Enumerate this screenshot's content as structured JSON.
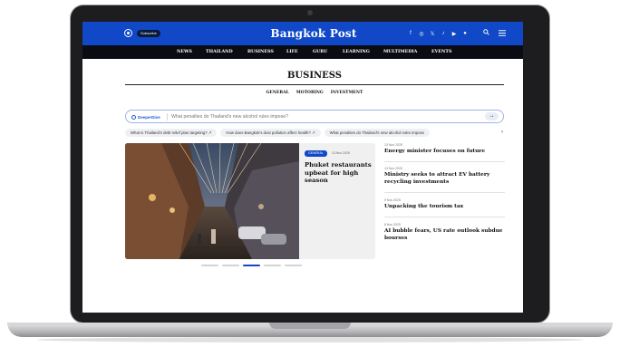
{
  "header": {
    "subscribe_label": "Subscribe",
    "logo_text": "Bangkok Post",
    "social_icons": [
      "facebook-icon",
      "instagram-icon",
      "x-icon",
      "tiktok-icon",
      "youtube-icon",
      "line-icon"
    ],
    "brand_color": "#1048c8"
  },
  "nav": {
    "items": [
      "NEWS",
      "THAILAND",
      "BUSINESS",
      "LIFE",
      "GURU",
      "LEARNING",
      "MULTIMEDIA",
      "EVENTS"
    ]
  },
  "section": {
    "title": "BUSINESS",
    "subnav": [
      "GENERAL",
      "MOTORING",
      "INVESTMENT"
    ]
  },
  "deeper_dive": {
    "brand": "DeeperDive",
    "placeholder": "What penalties do Thailand's new alcohol rules impose?",
    "go_symbol": "→",
    "chips": [
      "What is Thailand's debt relief plan targeting? ↗",
      "How does Bangkok's dust pollution affect health? ↗",
      "What penalties do Thailand's new alcohol rules impose"
    ],
    "chips_next": "›"
  },
  "feature": {
    "badge": "GENERAL",
    "date": "13 Nov 2025",
    "title": "Phuket restaurants upbeat for high season"
  },
  "stories": [
    {
      "date": "13 Nov 2025",
      "title": "Energy minister focuses on future"
    },
    {
      "date": "13 Nov 2025",
      "title": "Ministry seeks to attract EV battery recycling investments"
    },
    {
      "date": "9 Nov 2025",
      "title": "Unpacking the tourism tax"
    },
    {
      "date": "8 Nov 2025",
      "title": "AI bubble fears, US rate outlook subdue bourses"
    }
  ],
  "carousel": {
    "total": 5,
    "active": 3
  }
}
